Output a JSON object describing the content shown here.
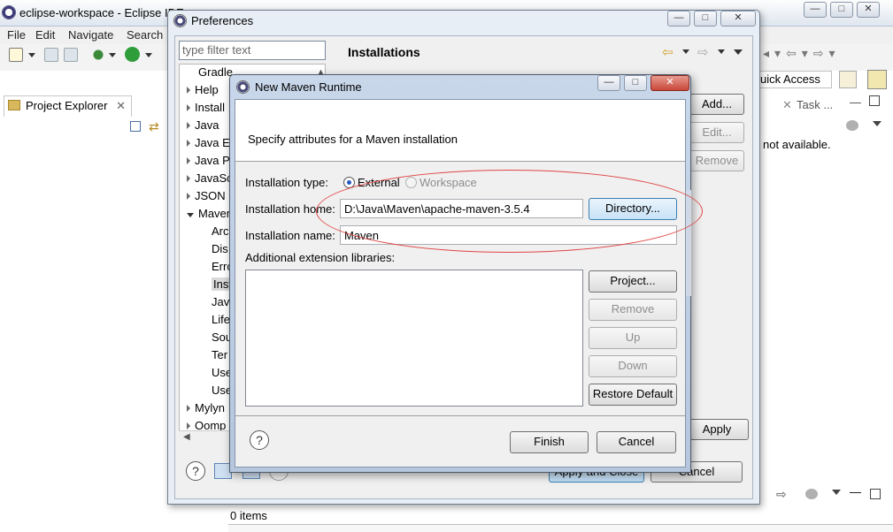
{
  "eclipse": {
    "window_title": "eclipse-workspace - Eclipse IDE",
    "menu": [
      "File",
      "Edit",
      "Navigate",
      "Search"
    ],
    "project_explorer_tab": "Project Explorer",
    "quick_access": "uick Access",
    "task_tab": "Task ...",
    "not_available": "not available.",
    "status_items": "0 items"
  },
  "preferences": {
    "title": "Preferences",
    "filter_placeholder": "type filter text",
    "heading": "Installations",
    "tree": [
      {
        "label": "Gradle",
        "expander": "none",
        "indent": 0
      },
      {
        "label": "Help",
        "expander": "right",
        "indent": 0
      },
      {
        "label": "Install",
        "expander": "right",
        "indent": 0
      },
      {
        "label": "Java",
        "expander": "right",
        "indent": 0
      },
      {
        "label": "Java E",
        "expander": "right",
        "indent": 0
      },
      {
        "label": "Java P",
        "expander": "right",
        "indent": 0
      },
      {
        "label": "JavaSc",
        "expander": "right",
        "indent": 0
      },
      {
        "label": "JSON",
        "expander": "right",
        "indent": 0
      },
      {
        "label": "Maven",
        "expander": "down",
        "indent": 0
      },
      {
        "label": "Arc",
        "expander": "none",
        "indent": 1
      },
      {
        "label": "Dis",
        "expander": "none",
        "indent": 1
      },
      {
        "label": "Erro",
        "expander": "none",
        "indent": 1
      },
      {
        "label": "Inst",
        "expander": "none",
        "indent": 1
      },
      {
        "label": "Java",
        "expander": "none",
        "indent": 1
      },
      {
        "label": "Life",
        "expander": "none",
        "indent": 1
      },
      {
        "label": "Sou",
        "expander": "none",
        "indent": 1
      },
      {
        "label": "Ter",
        "expander": "none",
        "indent": 1
      },
      {
        "label": "Use",
        "expander": "none",
        "indent": 1
      },
      {
        "label": "Use",
        "expander": "none",
        "indent": 1
      },
      {
        "label": "Mylyn",
        "expander": "right",
        "indent": 0
      },
      {
        "label": "Oomp",
        "expander": "right",
        "indent": 0
      }
    ],
    "buttons": {
      "add": "Add...",
      "edit": "Edit...",
      "remove": "Remove",
      "apply": "Apply",
      "apply_and_close": "Apply and Close",
      "cancel": "Cancel"
    }
  },
  "new_maven_runtime": {
    "title": "New Maven Runtime",
    "description": "Specify attributes for a Maven installation",
    "installation_type_label": "Installation type:",
    "radio_external": "External",
    "radio_workspace": "Workspace",
    "installation_home_label": "Installation home:",
    "installation_home_value": "D:\\Java\\Maven\\apache-maven-3.5.4",
    "directory_button": "Directory...",
    "installation_name_label": "Installation name:",
    "installation_name_value": "Maven",
    "extensions_label": "Additional extension libraries:",
    "buttons": {
      "project": "Project...",
      "remove": "Remove",
      "up": "Up",
      "down": "Down",
      "restore_default": "Restore Default",
      "finish": "Finish",
      "cancel": "Cancel"
    },
    "help_symbol": "?"
  },
  "colors": {
    "annotation_ellipse": "#e04444",
    "selection_radio": "#2356c4",
    "close_button": "#c9483b"
  }
}
